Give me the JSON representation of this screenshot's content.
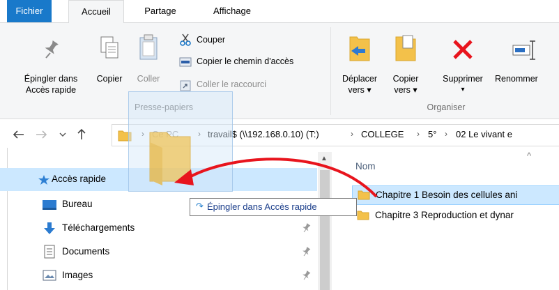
{
  "tabs": {
    "file": "Fichier",
    "home": "Accueil",
    "share": "Partage",
    "view": "Affichage"
  },
  "ribbon": {
    "pin_line1": "Épingler dans",
    "pin_line2": "Accès rapide",
    "copy": "Copier",
    "paste": "Coller",
    "cut": "Couper",
    "copy_path": "Copier le chemin d'accès",
    "paste_shortcut": "Coller le raccourci",
    "clipboard_group": "Presse-papiers",
    "move_line1": "Déplacer",
    "move_line2": "vers ▾",
    "copyto_line1": "Copier",
    "copyto_line2": "vers ▾",
    "delete": "Supprimer",
    "delete_arrow": "▾",
    "rename": "Renommer",
    "organize_group": "Organiser"
  },
  "address": {
    "crumbs": [
      "Ce PC",
      "travail$ (\\\\192.168.0.10) (T:)",
      "COLLEGE",
      "5°",
      "02 Le vivant e"
    ]
  },
  "nav": {
    "quick_access": "Accès rapide",
    "items": [
      "Bureau",
      "Téléchargements",
      "Documents",
      "Images"
    ]
  },
  "list": {
    "column_name": "Nom",
    "rows": [
      "Chapitre 1 Besoin des cellules ani",
      "Chapitre 3 Reproduction et dynar"
    ]
  },
  "tooltip": {
    "icon": "↷",
    "text": "Épingler dans Accès rapide"
  },
  "colors": {
    "accent": "#1979ca",
    "arrow": "#e8141d",
    "selection": "#cce8ff",
    "folder": "#f7c94a"
  }
}
